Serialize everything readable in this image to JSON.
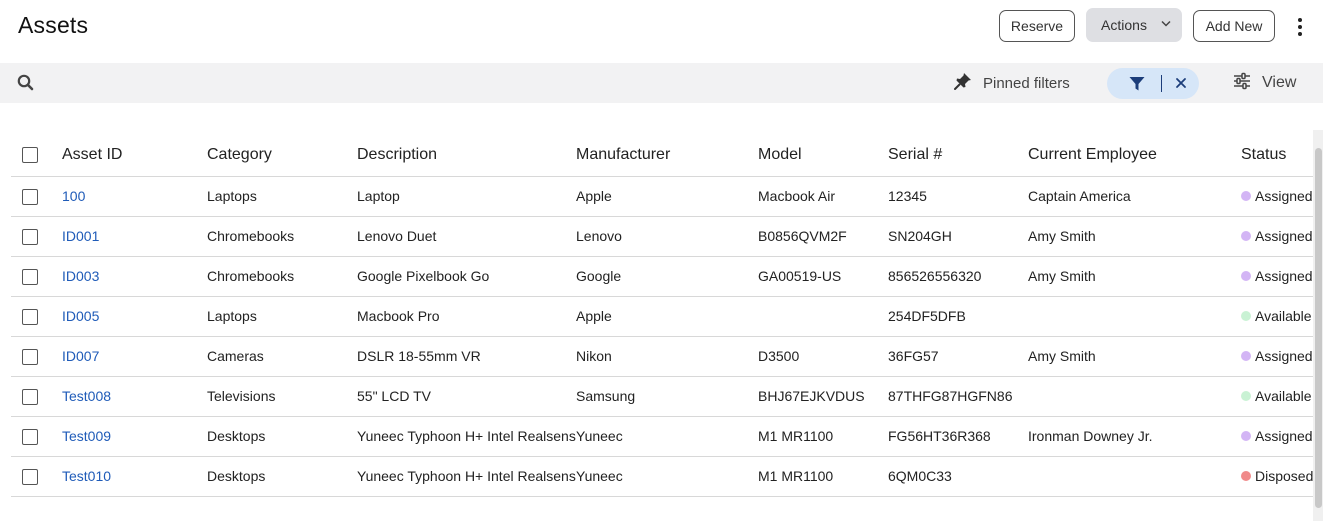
{
  "header": {
    "title": "Assets",
    "reserve_label": "Reserve",
    "actions_label": "Actions",
    "add_new_label": "Add New"
  },
  "toolbar": {
    "pinned_filters_label": "Pinned filters",
    "view_label": "View"
  },
  "colors": {
    "link": "#1f5bb8",
    "filter_pill_bg": "#d6e6f8",
    "status_assigned": "#d3b5f5",
    "status_available": "#c9f2d4",
    "status_disposed": "#f08a8a"
  },
  "table": {
    "columns": [
      "Asset ID",
      "Category",
      "Description",
      "Manufacturer",
      "Model",
      "Serial #",
      "Current Employee",
      "Status"
    ],
    "rows": [
      {
        "asset_id": "100",
        "category": "Laptops",
        "description": "Laptop",
        "manufacturer": "Apple",
        "model": "Macbook Air",
        "serial": "12345",
        "employee": "Captain America",
        "status": "Assigned t",
        "status_type": "assigned"
      },
      {
        "asset_id": "ID001",
        "category": "Chromebooks",
        "description": "Lenovo Duet",
        "manufacturer": "Lenovo",
        "model": "B0856QVM2F",
        "serial": "SN204GH",
        "employee": "Amy Smith",
        "status": "Assigned t",
        "status_type": "assigned"
      },
      {
        "asset_id": "ID003",
        "category": "Chromebooks",
        "description": "Google Pixelbook Go",
        "manufacturer": "Google",
        "model": "GA00519-US",
        "serial": "856526556320",
        "employee": "Amy Smith",
        "status": "Assigned t",
        "status_type": "assigned"
      },
      {
        "asset_id": "ID005",
        "category": "Laptops",
        "description": "Macbook Pro",
        "manufacturer": "Apple",
        "model": "",
        "serial": "254DF5DFB",
        "employee": "",
        "status": "Available",
        "status_type": "available"
      },
      {
        "asset_id": "ID007",
        "category": "Cameras",
        "description": "DSLR 18-55mm VR",
        "manufacturer": "Nikon",
        "model": "D3500",
        "serial": "36FG57",
        "employee": "Amy Smith",
        "status": "Assigned t",
        "status_type": "assigned"
      },
      {
        "asset_id": "Test008",
        "category": "Televisions",
        "description": "55\" LCD TV",
        "manufacturer": "Samsung",
        "model": "BHJ67EJKVDUS",
        "serial": "87THFG87HGFN86",
        "employee": "",
        "status": "Available",
        "status_type": "available"
      },
      {
        "asset_id": "Test009",
        "category": "Desktops",
        "description": "Yuneec Typhoon H+ Intel Realsens",
        "manufacturer": "Yuneec",
        "model": "M1 MR1100",
        "serial": "FG56HT36R368",
        "employee": "Ironman Downey Jr.",
        "status": "Assigned t",
        "status_type": "assigned"
      },
      {
        "asset_id": "Test010",
        "category": "Desktops",
        "description": "Yuneec Typhoon H+ Intel Realsens",
        "manufacturer": "Yuneec",
        "model": "M1 MR1100",
        "serial": "6QM0C33",
        "employee": "",
        "status": "Disposed",
        "status_type": "disposed"
      }
    ]
  }
}
